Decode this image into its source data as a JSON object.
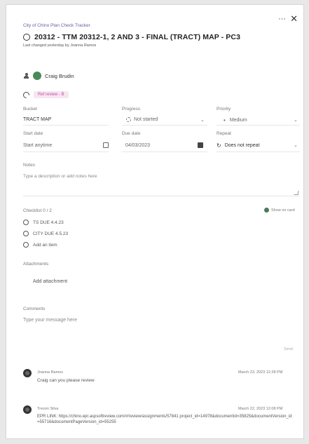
{
  "window": {
    "more_label": "···",
    "close_label": "✕"
  },
  "task": {
    "plan_name": "City of Chino Plan Check Tracker",
    "title": "20312 - TTM 20312-1, 2 AND 3 - FINAL (TRACT) MAP - PC3",
    "last_changed": "Last changed yesterday by Joanna Ramos"
  },
  "assignee": {
    "name": "Craig Brudin"
  },
  "label": {
    "text": "Ref review - B"
  },
  "fields": {
    "bucket": {
      "label": "Bucket",
      "value": "TRACT MAP"
    },
    "progress": {
      "label": "Progress",
      "value": "Not started"
    },
    "priority": {
      "label": "Priority",
      "value": "Medium"
    },
    "start_date": {
      "label": "Start date",
      "value": "Start anytime"
    },
    "due_date": {
      "label": "Due date",
      "value": "04/03/2023"
    },
    "repeat": {
      "label": "Repeat",
      "value": "Does not repeat"
    }
  },
  "notes": {
    "label": "Notes",
    "placeholder": "Type a description or add notes here"
  },
  "checklist": {
    "title": "Checklist 0 / 2",
    "show_on_card": "Show on card",
    "items": [
      "TS DUE 4.4.23",
      "CITY DUE 4.5.23"
    ],
    "add_item": "Add an item"
  },
  "attachments": {
    "label": "Attachments",
    "add": "Add attachment"
  },
  "comments": {
    "label": "Comments",
    "placeholder": "Type your message here",
    "send": "Send",
    "entries": [
      {
        "author": "Joanna Ramos",
        "time": "March 23, 2023 12:28 PM",
        "text": "Craig can you please review"
      },
      {
        "author": "Trevon Silva",
        "time": "March 22, 2023 12:08 PM",
        "text": "EPR LINK: https://chino.epr.aspsoftreview.com/#/review/assignments/57841 project_id=14978&documentId=35825&documentVersion_id=55716&documentPageVersion_id=55255"
      }
    ]
  }
}
